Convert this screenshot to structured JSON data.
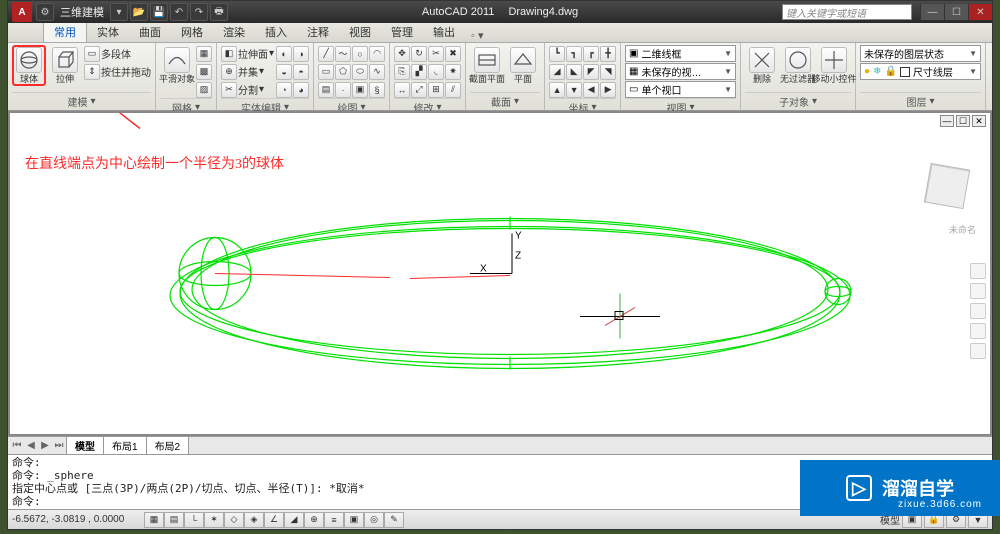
{
  "title": {
    "app": "AutoCAD 2011",
    "file": "Drawing4.dwg",
    "workspace": "三维建模"
  },
  "search_placeholder": "键入关键字或短语",
  "tabs": [
    "常用",
    "实体",
    "曲面",
    "网格",
    "渲染",
    "插入",
    "注释",
    "视图",
    "管理",
    "输出"
  ],
  "active_tab": "常用",
  "ribbon": {
    "modeling": {
      "label": "建模",
      "sphere": "球体",
      "extrude": "拉伸",
      "polysolid": "多段体",
      "presspull": "按住并拖动",
      "smooth": "平滑对象"
    },
    "mesh": {
      "label": "网格"
    },
    "solid_edit": {
      "label": "实体编辑",
      "sweep": "拉伸面",
      "union": "并集",
      "split": "分割"
    },
    "draw": {
      "label": "绘图"
    },
    "modify": {
      "label": "修改"
    },
    "section": {
      "label": "截面",
      "plane": "截面平面",
      "flat": "平面"
    },
    "coord": {
      "label": "坐标"
    },
    "layer": {
      "label": "图层",
      "wire2d": "二维线框",
      "unsaved_view": "未保存的视…",
      "single_vp": "单个视口"
    },
    "view": {
      "label": "视图",
      "delete": "删除",
      "nofilter": "无过滤器",
      "move_gizmo": "移动小控件"
    },
    "subobj": {
      "label": "子对象"
    },
    "layerstate": {
      "label": "图层",
      "unsaved": "未保存的图层状态",
      "dim": "尺寸线层"
    }
  },
  "annotation": "在直线端点为中心绘制一个半径为3的球体",
  "axes": {
    "x": "X",
    "y": "Y",
    "z": "Z"
  },
  "viewcube": {
    "caption": "未命名"
  },
  "layout_tabs": [
    "模型",
    "布局1",
    "布局2"
  ],
  "active_layout": "模型",
  "cmd": {
    "l1": "命令:",
    "l2": "命令:  _sphere",
    "l3": "指定中心点或 [三点(3P)/两点(2P)/切点、切点、半径(T)]: *取消*",
    "l4": "命令:"
  },
  "status": {
    "coords": "-6.5672, -3.0819 , 0.0000",
    "right_label": "模型"
  },
  "watermark": {
    "brand": "溜溜自学",
    "url": "zixue.3d66.com"
  }
}
